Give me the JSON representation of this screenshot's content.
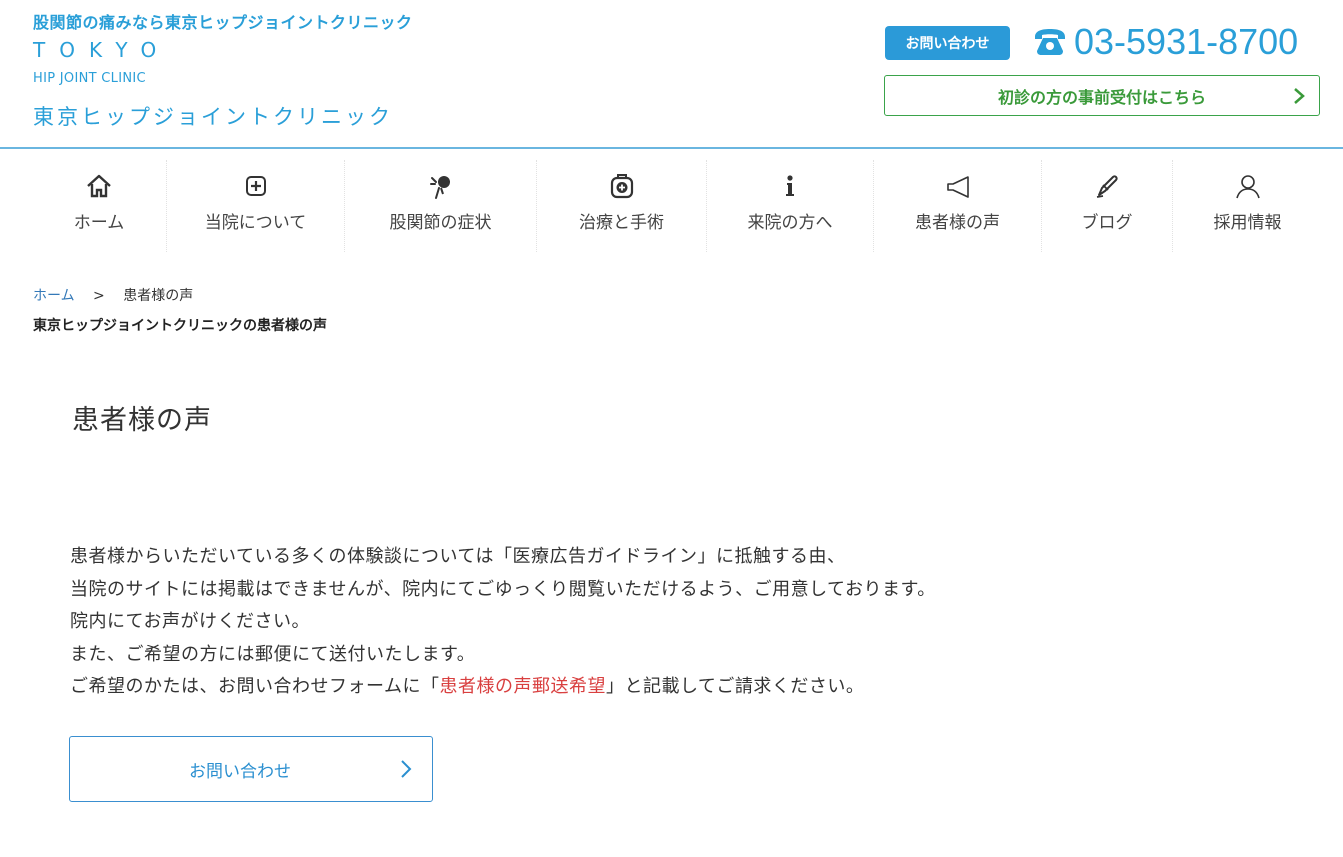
{
  "header": {
    "tagline": "股関節の痛みなら東京ヒップジョイントクリニック",
    "logo_tokyo": "TOKYO",
    "logo_subtitle": "HIP JOINT CLINIC",
    "clinic_name": "東京ヒップジョイントクリニック",
    "contact_button": "お問い合わせ",
    "phone_number": "03-5931-8700",
    "reserve_button": "初診の方の事前受付はこちら"
  },
  "nav": {
    "items": [
      {
        "label": "ホーム",
        "icon": "home-icon"
      },
      {
        "label": "当院について",
        "icon": "plus-square-icon"
      },
      {
        "label": "股関節の症状",
        "icon": "joint-icon"
      },
      {
        "label": "治療と手術",
        "icon": "medical-bag-icon"
      },
      {
        "label": "来院の方へ",
        "icon": "info-icon"
      },
      {
        "label": "患者様の声",
        "icon": "megaphone-icon"
      },
      {
        "label": "ブログ",
        "icon": "pen-icon"
      },
      {
        "label": "採用情報",
        "icon": "user-icon"
      }
    ]
  },
  "breadcrumb": {
    "home": "ホーム",
    "separator": ">",
    "current": "患者様の声"
  },
  "page": {
    "subtitle": "東京ヒップジョイントクリニックの患者様の声",
    "title": "患者様の声",
    "lines": [
      "患者様からいただいている多くの体験談については「医療広告ガイドライン」に抵触する由、",
      "当院のサイトには掲載はできませんが、院内にてごゆっくり閲覧いただけるよう、ご用意しております。",
      "院内にてお声がけください。",
      "また、ご希望の方には郵便にて送付いたします。"
    ],
    "last_line_before": "ご希望のかたは、お問い合わせフォームに「",
    "last_line_highlight": "患者様の声郵送希望",
    "last_line_after": "」と記載してご請求ください。",
    "cta_label": "お問い合わせ"
  },
  "colors": {
    "brand_blue": "#2a9fd8",
    "green": "#3aa34a",
    "highlight_red": "#d94040"
  }
}
